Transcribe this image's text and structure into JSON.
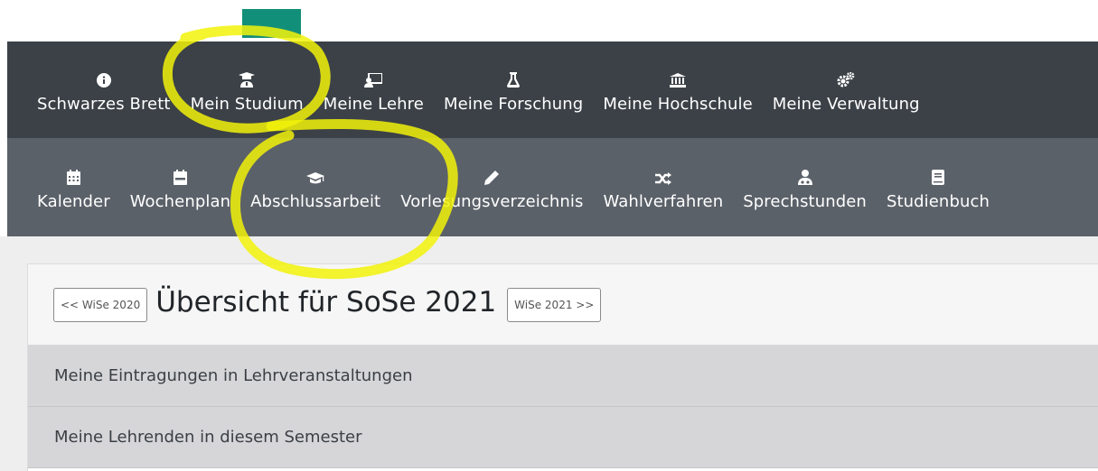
{
  "main_nav": {
    "items": [
      {
        "label": "Schwarzes Brett",
        "icon": "info-circle-icon"
      },
      {
        "label": "Mein Studium",
        "icon": "graduate-student-icon"
      },
      {
        "label": "Meine Lehre",
        "icon": "teacher-board-icon"
      },
      {
        "label": "Meine Forschung",
        "icon": "flask-icon"
      },
      {
        "label": "Meine Hochschule",
        "icon": "university-building-icon"
      },
      {
        "label": "Meine Verwaltung",
        "icon": "gears-icon"
      }
    ]
  },
  "sub_nav": {
    "items": [
      {
        "label": "Kalender",
        "icon": "calendar-grid-icon"
      },
      {
        "label": "Wochenplan",
        "icon": "calendar-week-icon"
      },
      {
        "label": "Abschlussarbeit",
        "icon": "graduation-cap-icon"
      },
      {
        "label": "Vorlesungsverzeichnis",
        "icon": "pencil-icon"
      },
      {
        "label": "Wahlverfahren",
        "icon": "shuffle-icon"
      },
      {
        "label": "Sprechstunden",
        "icon": "doctor-icon"
      },
      {
        "label": "Studienbuch",
        "icon": "book-icon"
      }
    ]
  },
  "overview": {
    "prev_button": "<< WiSe 2020",
    "title": "Übersicht für SoSe 2021",
    "next_button": "WiSe 2021 >>"
  },
  "sections": [
    {
      "label": "Meine Eintragungen in Lehrveranstaltungen"
    },
    {
      "label": "Meine Lehrenden in diesem Semester"
    }
  ],
  "colors": {
    "main_nav_bg": "#3b4147",
    "sub_nav_bg": "#5b6169",
    "highlight_marker": "#f2f20a",
    "teal_block": "#128f78"
  }
}
